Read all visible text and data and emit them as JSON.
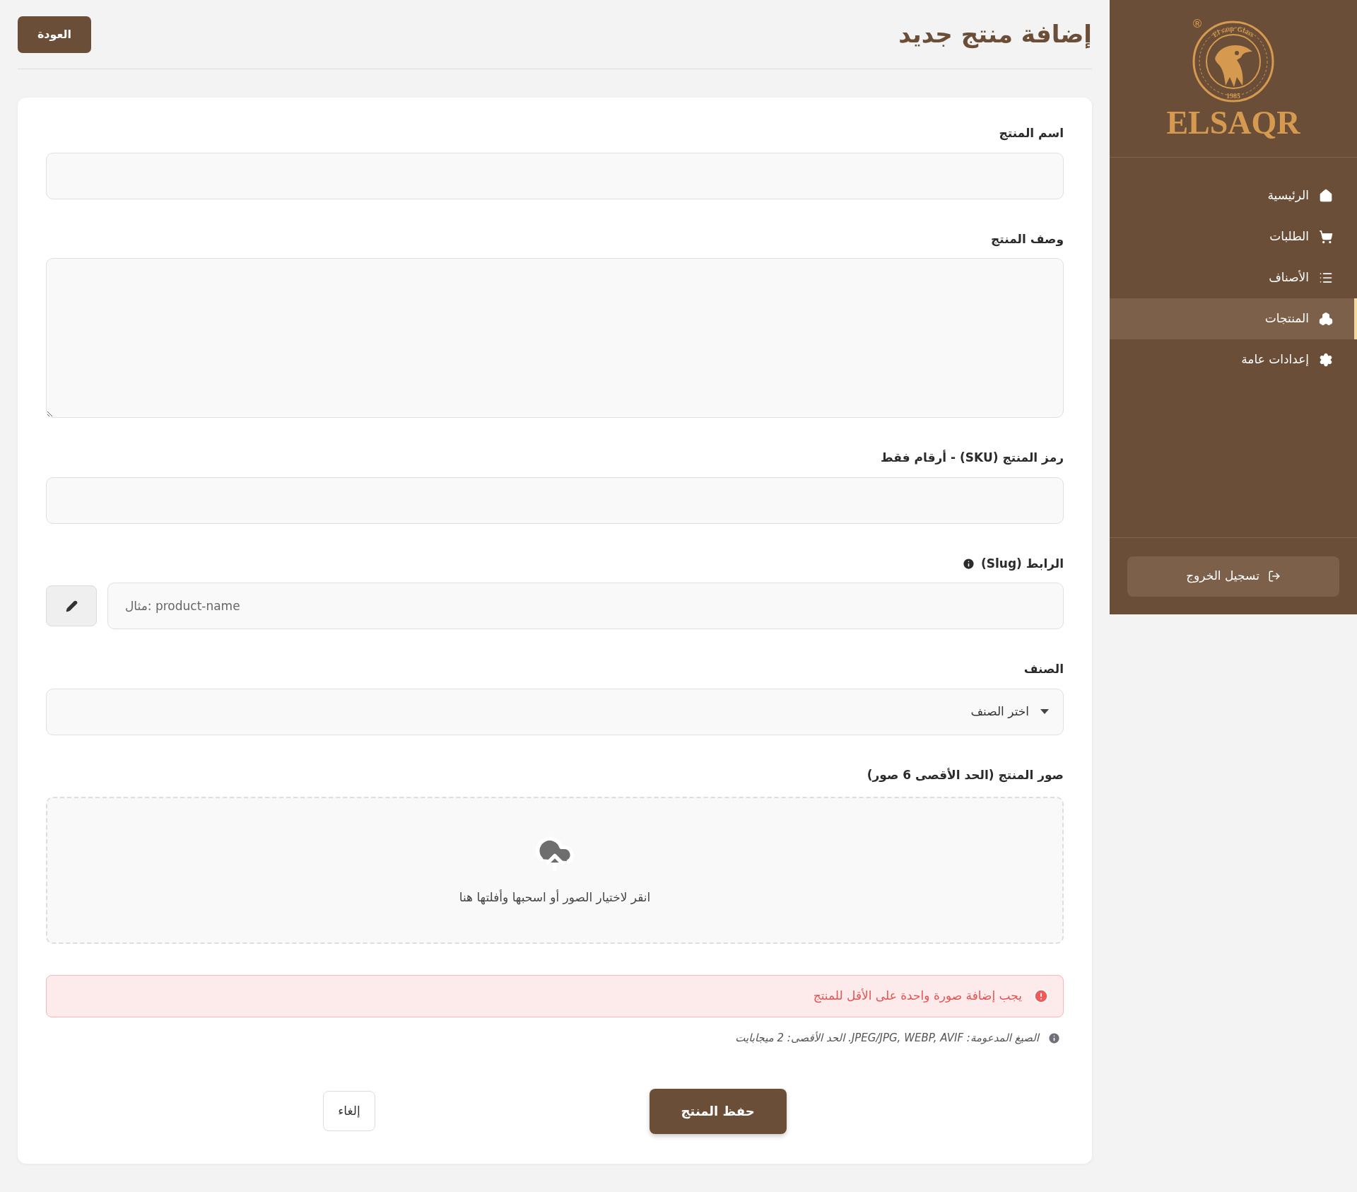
{
  "sidebar": {
    "logo": {
      "ring_text": "El saqr Glass",
      "year": "1985",
      "registered": "®",
      "wordmark": "ELSAQR"
    },
    "items": [
      {
        "label": "الرئيسية",
        "selected": false
      },
      {
        "label": "الطلبات",
        "selected": false
      },
      {
        "label": "الأصناف",
        "selected": false
      },
      {
        "label": "المنتجات",
        "selected": true
      },
      {
        "label": "إعدادات عامة",
        "selected": false
      }
    ],
    "logout": "تسجيل الخروج"
  },
  "header": {
    "title": "إضافة منتج جديد",
    "back_button": "العودة"
  },
  "form": {
    "fields": [
      {
        "kind": "text",
        "label": "اسم المنتج"
      },
      {
        "kind": "textarea",
        "label": "وصف المنتج"
      },
      {
        "kind": "text",
        "label": "رمز المنتج (SKU) - أرقام فقط"
      },
      {
        "kind": "slug",
        "label": "الرابط (Slug)",
        "placeholder": "مثال: product-name"
      },
      {
        "kind": "select",
        "label": "الصنف",
        "value": "اختر الصنف"
      },
      {
        "kind": "upload",
        "label": "صور المنتج (الحد الأقصى 6 صور)",
        "prompt": "انقر لاختيار الصور أو اسحبها وأفلتها هنا"
      }
    ],
    "error": "يجب إضافة صورة واحدة على الأقل للمنتج",
    "hint": "الصيغ المدعومة: JPEG/JPG, WEBP, AVIF. الحد الأقصى: 2 ميجابايت",
    "save_button": "حفظ المنتج",
    "cancel_button": "إلغاء"
  }
}
